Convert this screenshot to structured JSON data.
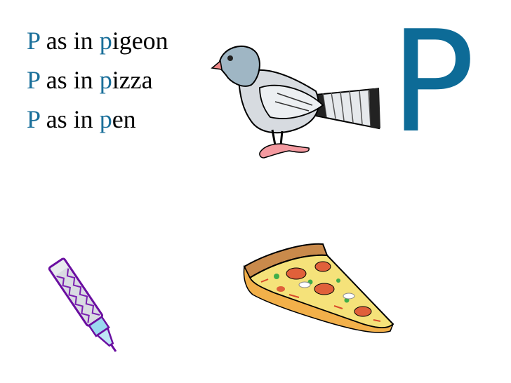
{
  "lines": [
    {
      "first": "P",
      "middle": " as in ",
      "initial": "p",
      "rest": "igeon"
    },
    {
      "first": "P",
      "middle": " as in ",
      "initial": "p",
      "rest": "izza"
    },
    {
      "first": "P",
      "middle": " as in ",
      "initial": "p",
      "rest": "en"
    }
  ],
  "big_letter": "P",
  "colors": {
    "accent": "#1a6f9a",
    "letter": "#0d6b97"
  },
  "images": [
    "pigeon-illustration",
    "pen-illustration",
    "pizza-slice-illustration"
  ]
}
